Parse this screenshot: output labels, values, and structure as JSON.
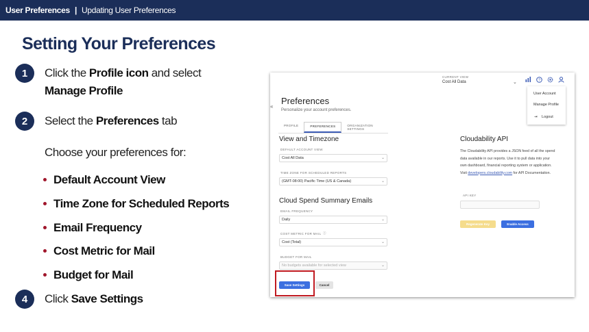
{
  "header": {
    "section": "User Preferences",
    "separator": "|",
    "subsection": "Updating User Preferences"
  },
  "title": "Setting Your Preferences",
  "steps": [
    {
      "num": "1",
      "pre": "Click the ",
      "bold": "Profile icon",
      "mid": " and select",
      "bold2": "Manage Profile"
    },
    {
      "num": "2",
      "pre": "Select the ",
      "bold": "Preferences",
      "mid": " tab"
    },
    {
      "num": "4",
      "pre": "Click ",
      "bold": "Save Settings"
    }
  ],
  "choose_text": "Choose your preferences for:",
  "bullets": [
    "Default Account View",
    "Time Zone for Scheduled Reports",
    "Email Frequency",
    "Cost Metric for Mail",
    "Budget for Mail"
  ],
  "app": {
    "current_view_label": "CURRENT VIEW",
    "current_view_value": "Cost All Data",
    "page_title": "Preferences",
    "page_subtitle": "Personalize your account preferences.",
    "tabs": [
      "PROFILE",
      "PREFERENCES",
      "ORGANIZATION SETTINGS"
    ],
    "menu": [
      "User Account",
      "Manage Profile",
      "Logout"
    ],
    "view_timezone_title": "View and Timezone",
    "default_view_label": "DEFAULT ACCOUNT VIEW",
    "default_view_value": "Cost All Data",
    "timezone_label": "TIME ZONE FOR SCHEDULED REPORTS",
    "timezone_value": "(GMT-08:00) Pacific Time (US & Canada)",
    "emails_title": "Cloud Spend Summary Emails",
    "email_freq_label": "EMAIL FREQUENCY",
    "email_freq_value": "Daily",
    "cost_metric_label": "COST METRIC FOR MAIL",
    "cost_metric_value": "Cost (Total)",
    "budget_label": "BUDGET FOR MAIL",
    "budget_value": "No budgets available for selected view",
    "api_title": "Cloudability API",
    "api_text_1": "The Cloudability API provides a JSON feed of all the spend data available in our reports. Use it to pull data into your own dashboard, financial reporting system or application. Visit ",
    "api_link": "developers.cloudability.com",
    "api_text_2": " for API Documentation.",
    "api_key_label": "API KEY",
    "regenerate_label": "Regenerate Key",
    "enable_label": "Enable Access",
    "save_label": "Save Settings",
    "cancel_label": "Cancel"
  }
}
